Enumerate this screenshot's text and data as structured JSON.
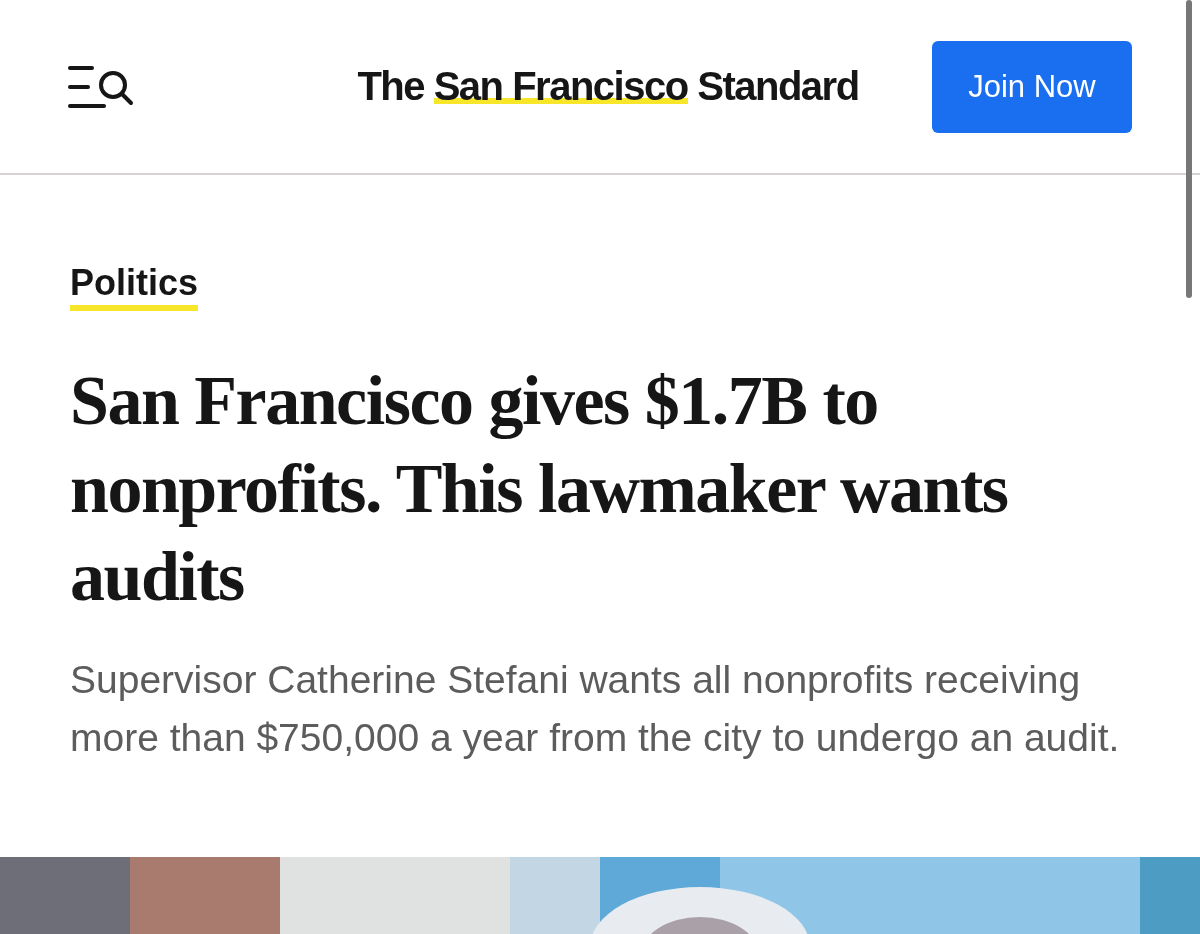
{
  "header": {
    "logo": {
      "before": "The",
      "highlight": "San Francisco",
      "after": "Standard"
    },
    "join_button": "Join Now"
  },
  "article": {
    "section": "Politics",
    "headline": "San Francisco gives $1.7B to nonprofits. This lawmaker wants audits",
    "dek": "Supervisor Catherine Stefani wants all nonprofits receiving more than $750,000 a year from the city to undergo an audit."
  }
}
